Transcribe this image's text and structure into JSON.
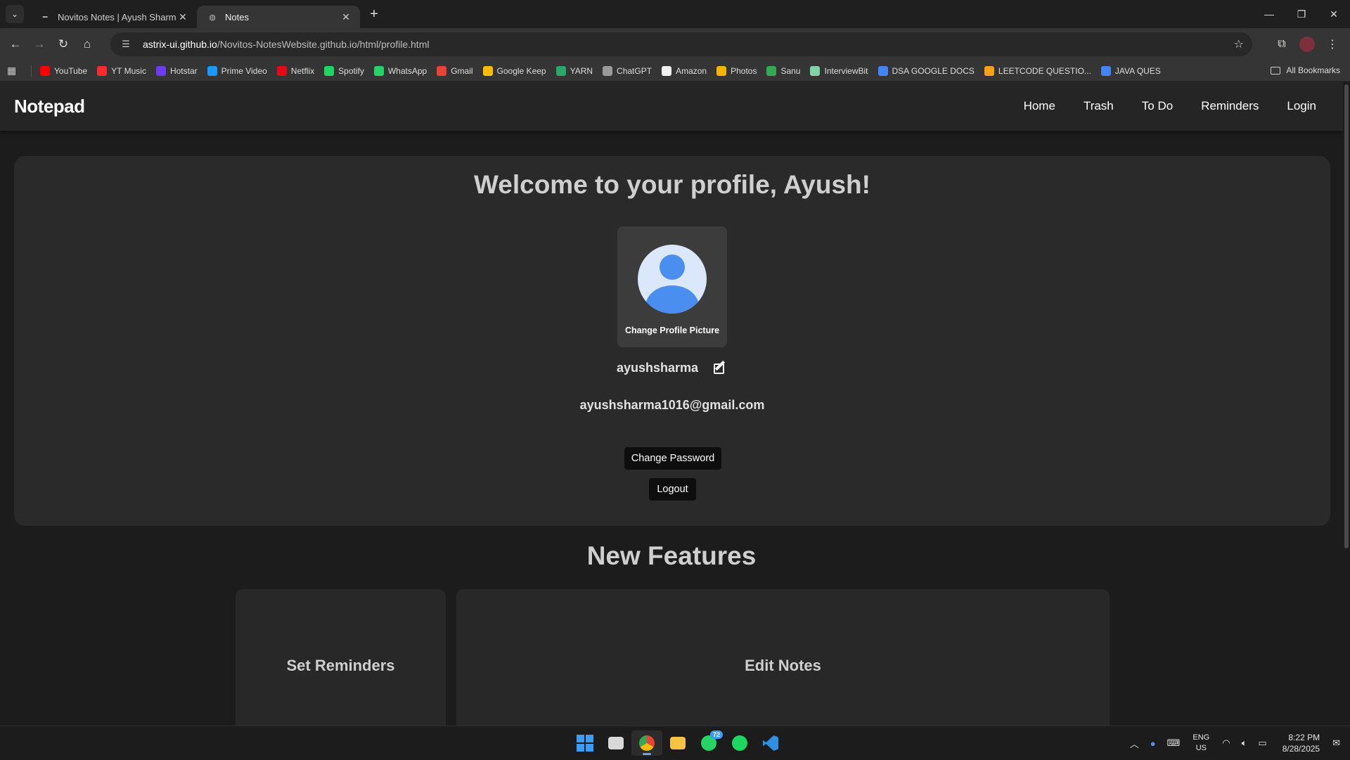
{
  "browser": {
    "tabs": [
      {
        "title": "Novitos Notes | Ayush Sharma",
        "active": false
      },
      {
        "title": "Notes",
        "active": true
      }
    ],
    "url_host": "astrix-ui.github.io",
    "url_path": "/Novitos-NotesWebsite.github.io/html/profile.html",
    "bookmarks": [
      {
        "label": "YouTube",
        "color": "#ff0000"
      },
      {
        "label": "YT Music",
        "color": "#ff2a2a"
      },
      {
        "label": "Hotstar",
        "color": "#6b3cf0"
      },
      {
        "label": "Prime Video",
        "color": "#1a98ff"
      },
      {
        "label": "Netflix",
        "color": "#e50914"
      },
      {
        "label": "Spotify",
        "color": "#1ed760"
      },
      {
        "label": "WhatsApp",
        "color": "#25d366"
      },
      {
        "label": "Gmail",
        "color": "#ea4335"
      },
      {
        "label": "Google Keep",
        "color": "#fbbc04"
      },
      {
        "label": "YARN",
        "color": "#2aa86a"
      },
      {
        "label": "ChatGPT",
        "color": "#9a9a9a"
      },
      {
        "label": "Amazon",
        "color": "#f0f0f0"
      },
      {
        "label": "Photos",
        "color": "#f4b400"
      },
      {
        "label": "Sanu",
        "color": "#34a853"
      },
      {
        "label": "InterviewBit",
        "color": "#7ed4a6"
      },
      {
        "label": "DSA GOOGLE DOCS",
        "color": "#4285f4"
      },
      {
        "label": "LEETCODE QUESTIO...",
        "color": "#f89f1b"
      },
      {
        "label": "JAVA QUES",
        "color": "#4285f4"
      }
    ],
    "all_bookmarks": "All Bookmarks"
  },
  "site": {
    "brand": "Notepad",
    "nav": [
      "Home",
      "Trash",
      "To Do",
      "Reminders",
      "Login"
    ]
  },
  "profile": {
    "welcome": "Welcome to your profile, Ayush!",
    "change_picture": "Change Profile Picture",
    "username": "ayushsharma",
    "email": "ayushsharma1016@gmail.com",
    "change_password": "Change Password",
    "logout": "Logout"
  },
  "features": {
    "title": "New Features",
    "cards": [
      "Set Reminders",
      "Edit Notes"
    ]
  },
  "taskbar": {
    "whatsapp_badge": "72",
    "lang_1": "ENG",
    "lang_2": "US",
    "time": "8:22 PM",
    "date": "8/28/2025"
  }
}
